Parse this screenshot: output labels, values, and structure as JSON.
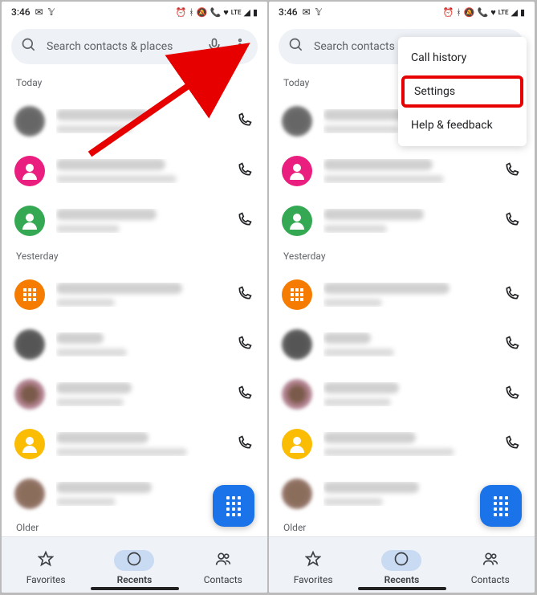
{
  "status": {
    "time": "3:46",
    "lte": "LTE"
  },
  "search": {
    "placeholder_full": "Search contacts & places",
    "placeholder_short": "Search contacts &"
  },
  "sections": {
    "today": "Today",
    "yesterday": "Yesterday",
    "older": "Older"
  },
  "nav": {
    "favorites": "Favorites",
    "recents": "Recents",
    "contacts": "Contacts"
  },
  "menu": {
    "call_history": "Call history",
    "settings": "Settings",
    "help": "Help & feedback"
  }
}
